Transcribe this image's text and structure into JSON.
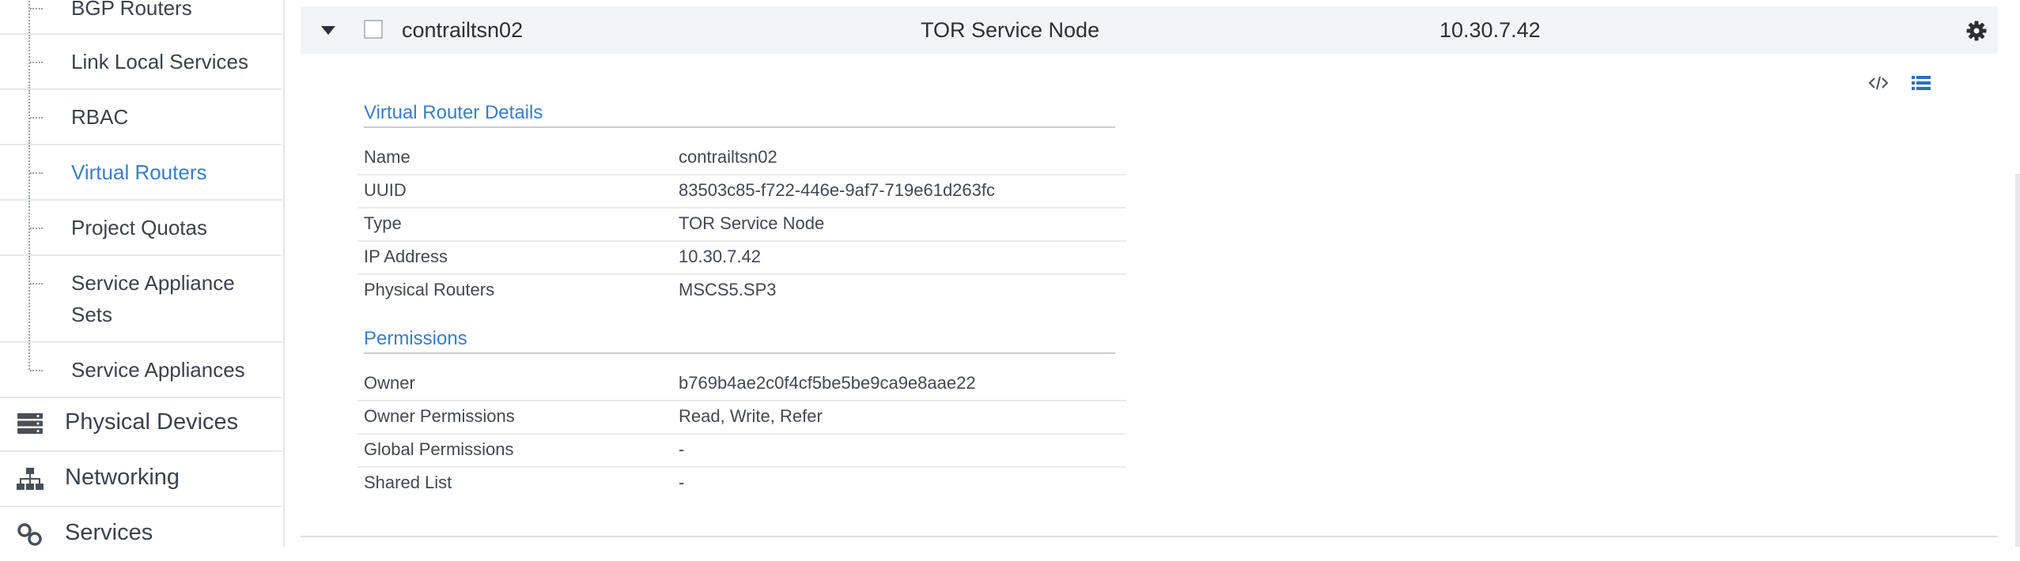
{
  "sidebar": {
    "sub_items": [
      {
        "label": "BGP Routers"
      },
      {
        "label": "Link Local Services"
      },
      {
        "label": "RBAC"
      },
      {
        "label": "Virtual Routers"
      },
      {
        "label": "Project Quotas"
      },
      {
        "label": "Service Appliance Sets"
      },
      {
        "label": "Service Appliances"
      }
    ],
    "top_items": [
      {
        "label": "Physical Devices",
        "icon": "server-icon"
      },
      {
        "label": "Networking",
        "icon": "sitemap-icon"
      },
      {
        "label": "Services",
        "icon": "link-icon"
      }
    ]
  },
  "row": {
    "name": "contrailtsn02",
    "type": "TOR Service Node",
    "ip": "10.30.7.42"
  },
  "details": {
    "title": "Virtual Router Details",
    "rows": [
      {
        "key": "Name",
        "value": "contrailtsn02"
      },
      {
        "key": "UUID",
        "value": "83503c85-f722-446e-9af7-719e61d263fc"
      },
      {
        "key": "Type",
        "value": "TOR Service Node"
      },
      {
        "key": "IP Address",
        "value": "10.30.7.42"
      },
      {
        "key": "Physical Routers",
        "value": "MSCS5.SP3"
      }
    ]
  },
  "permissions": {
    "title": "Permissions",
    "rows": [
      {
        "key": "Owner",
        "value": "b769b4ae2c0f4cf5be5be9ca9e8aae22"
      },
      {
        "key": "Owner Permissions",
        "value": "Read, Write, Refer"
      },
      {
        "key": "Global Permissions",
        "value": "-"
      },
      {
        "key": "Shared List",
        "value": "-"
      }
    ]
  },
  "colors": {
    "accent": "#3b7dc4",
    "header_bg": "#f3f4f6",
    "text": "#333333"
  }
}
